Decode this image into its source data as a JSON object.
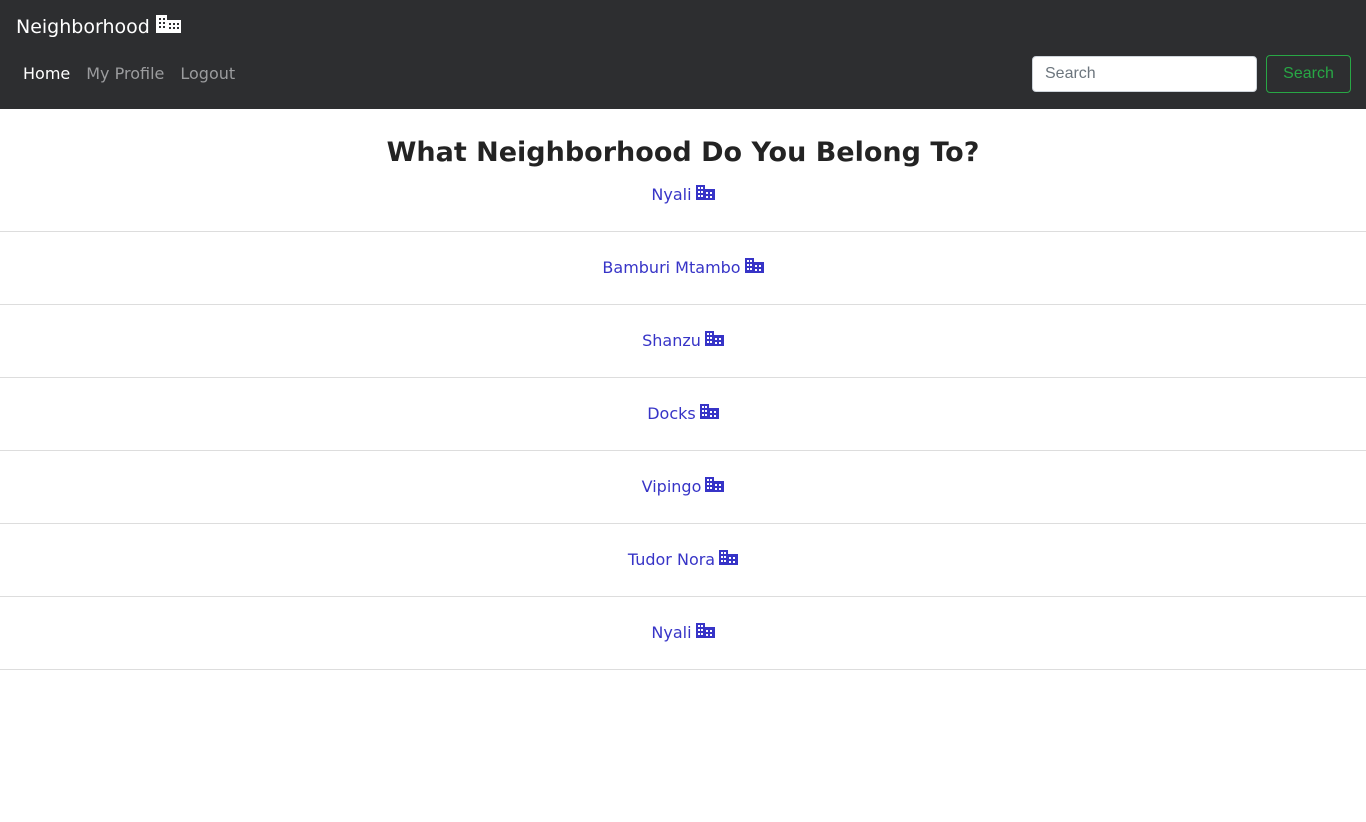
{
  "navbar": {
    "brand": "Neighborhood",
    "brand_icon": "building-icon",
    "links": [
      {
        "label": "Home",
        "active": true
      },
      {
        "label": "My Profile",
        "active": false
      },
      {
        "label": "Logout",
        "active": false
      }
    ],
    "search": {
      "placeholder": "Search",
      "value": ""
    },
    "search_button": "Search"
  },
  "main": {
    "title": "What Neighborhood Do You Belong To?",
    "neighborhoods": [
      {
        "name": "Nyali"
      },
      {
        "name": "Bamburi Mtambo"
      },
      {
        "name": "Shanzu"
      },
      {
        "name": "Docks"
      },
      {
        "name": "Vipingo"
      },
      {
        "name": "Tudor Nora"
      },
      {
        "name": "Nyali"
      }
    ],
    "item_icon": "building-icon"
  },
  "colors": {
    "navbar_bg": "#2d2e30",
    "link": "#3734c7",
    "success": "#28a745"
  }
}
